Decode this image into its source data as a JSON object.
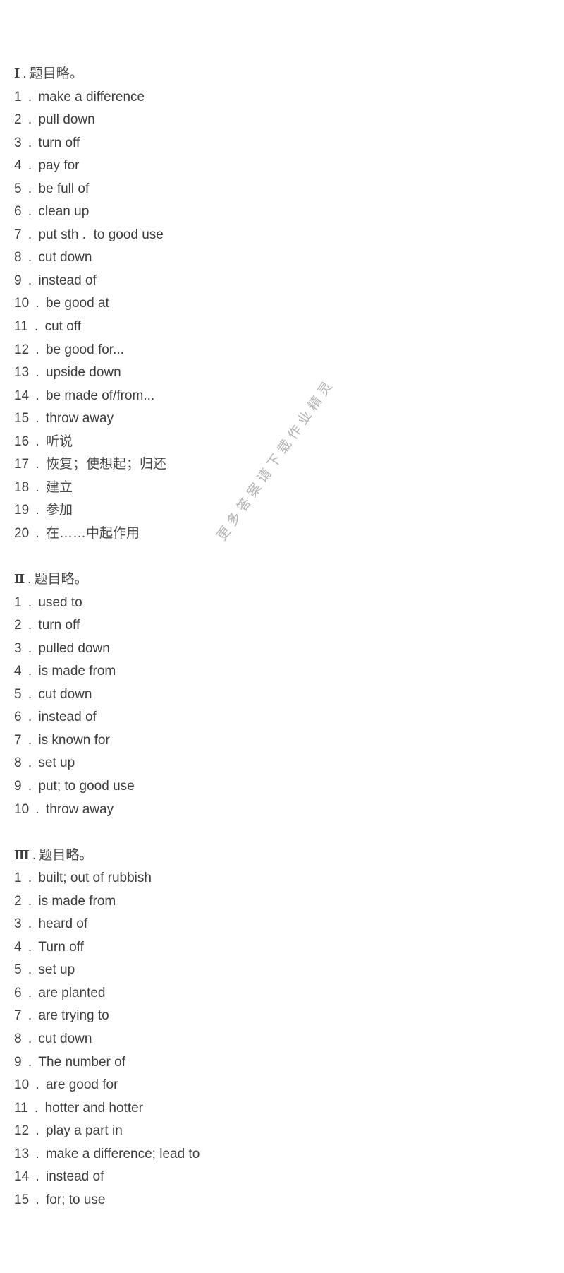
{
  "watermark": "更多答案请下载作业精灵",
  "sections": [
    {
      "numeral": "Ⅰ",
      "heading": "题目略。",
      "items": [
        {
          "n": "1",
          "text": "make a difference"
        },
        {
          "n": "2",
          "text": "pull down"
        },
        {
          "n": "3",
          "text": "turn off"
        },
        {
          "n": "4",
          "text": "pay for"
        },
        {
          "n": "5",
          "text": "be full of"
        },
        {
          "n": "6",
          "text": "clean up"
        },
        {
          "n": "7",
          "text": "put sth .  to good use"
        },
        {
          "n": "8",
          "text": "cut down"
        },
        {
          "n": "9",
          "text": "instead of"
        },
        {
          "n": "10",
          "text": "be good at"
        },
        {
          "n": "11",
          "text": "cut off"
        },
        {
          "n": "12",
          "text": "be good for..."
        },
        {
          "n": "13",
          "text": "upside down"
        },
        {
          "n": "14",
          "text": "be made of/from..."
        },
        {
          "n": "15",
          "text": "throw away"
        },
        {
          "n": "16",
          "text": "听说"
        },
        {
          "n": "17",
          "text": "恢复；使想起；归还"
        },
        {
          "n": "18",
          "text": "建立"
        },
        {
          "n": "19",
          "text": "参加"
        },
        {
          "n": "20",
          "text": "在……中起作用"
        }
      ]
    },
    {
      "numeral": "Ⅱ",
      "heading": "题目略。",
      "items": [
        {
          "n": "1",
          "text": "used to"
        },
        {
          "n": "2",
          "text": "turn off"
        },
        {
          "n": "3",
          "text": "pulled down"
        },
        {
          "n": "4",
          "text": "is made from"
        },
        {
          "n": "5",
          "text": "cut down"
        },
        {
          "n": "6",
          "text": "instead of"
        },
        {
          "n": "7",
          "text": "is known for"
        },
        {
          "n": "8",
          "text": "set up"
        },
        {
          "n": "9",
          "text": "put; to good use"
        },
        {
          "n": "10",
          "text": "throw away"
        }
      ]
    },
    {
      "numeral": "Ⅲ",
      "heading": "题目略。",
      "items": [
        {
          "n": "1",
          "text": "built; out of rubbish"
        },
        {
          "n": "2",
          "text": "is made from"
        },
        {
          "n": "3",
          "text": "heard of"
        },
        {
          "n": "4",
          "text": "Turn off"
        },
        {
          "n": "5",
          "text": "set up"
        },
        {
          "n": "6",
          "text": "are planted"
        },
        {
          "n": "7",
          "text": "are trying to"
        },
        {
          "n": "8",
          "text": "cut down"
        },
        {
          "n": "9",
          "text": "The number of"
        },
        {
          "n": "10",
          "text": "are good for"
        },
        {
          "n": "11",
          "text": "hotter and hotter"
        },
        {
          "n": "12",
          "text": "play a part in"
        },
        {
          "n": "13",
          "text": "make a difference; lead to"
        },
        {
          "n": "14",
          "text": "instead of"
        },
        {
          "n": "15",
          "text": "for; to use"
        }
      ]
    }
  ]
}
